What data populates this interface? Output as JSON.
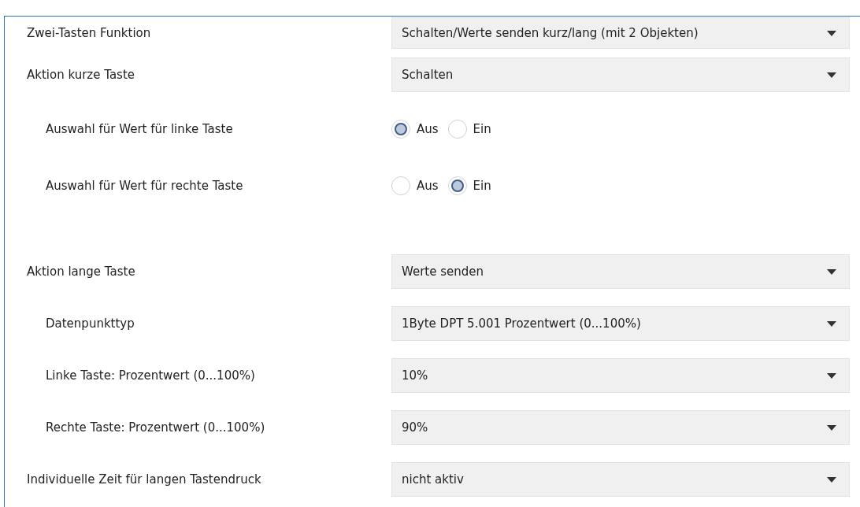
{
  "groups": [
    [
      {
        "kind": "dropdown",
        "label": "Zwei-Tasten Funktion",
        "value": "Schalten/Werte senden kurz/lang (mit 2 Objekten)"
      },
      {
        "kind": "dropdown",
        "label": "Aktion kurze Taste",
        "value": "Schalten",
        "children": [
          {
            "kind": "radio",
            "label": "Auswahl für Wert für linke Taste",
            "options": [
              {
                "label": "Aus",
                "selected": true
              },
              {
                "label": "Ein",
                "selected": false
              }
            ]
          },
          {
            "kind": "radio",
            "label": "Auswahl für Wert für rechte Taste",
            "options": [
              {
                "label": "Aus",
                "selected": false
              },
              {
                "label": "Ein",
                "selected": true
              }
            ]
          }
        ]
      }
    ],
    [
      {
        "kind": "dropdown",
        "label": "Aktion lange Taste",
        "value": "Werte senden",
        "children": [
          {
            "kind": "dropdown",
            "label": "Datenpunkttyp",
            "value": "1Byte DPT 5.001 Prozentwert (0...100%)"
          },
          {
            "kind": "dropdown",
            "label": "Linke Taste: Prozentwert (0...100%)",
            "value": "10%"
          },
          {
            "kind": "dropdown",
            "label": "Rechte Taste: Prozentwert (0...100%)",
            "value": "90%"
          }
        ]
      },
      {
        "kind": "dropdown",
        "label": "Individuelle Zeit für langen Tastendruck",
        "value": "nicht aktiv"
      }
    ]
  ]
}
